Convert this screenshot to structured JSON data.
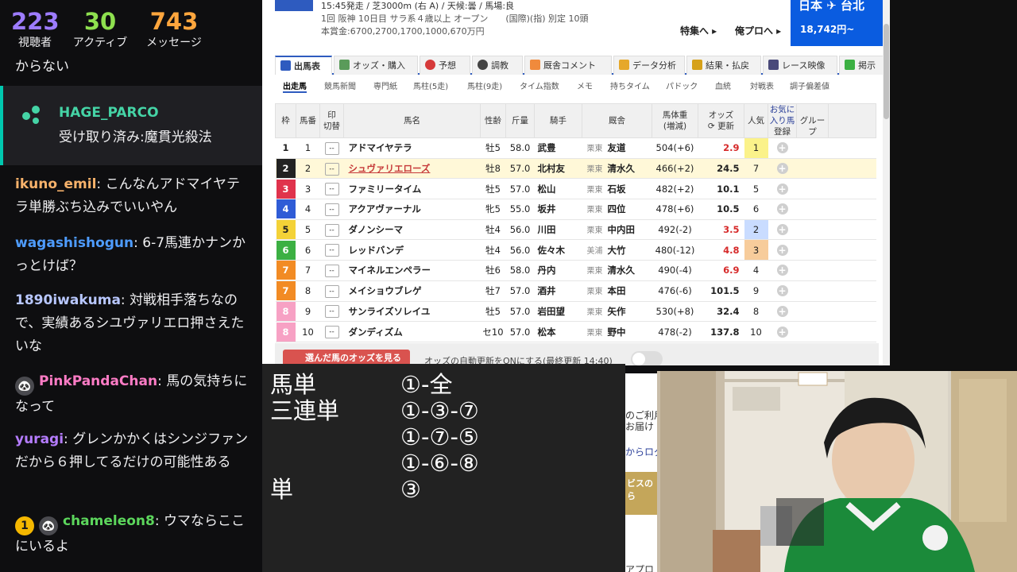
{
  "chat": {
    "stats": [
      {
        "value": "223",
        "label": "視聴者",
        "color": "#9d7cff"
      },
      {
        "value": "30",
        "label": "アクティブ",
        "color": "#8ee04f"
      },
      {
        "value": "743",
        "label": "メッセージ",
        "color": "#ffa63d"
      }
    ],
    "top_fragment": "からない",
    "redeem": {
      "user": "HAGE_PARCO",
      "text": "受け取り済み:魔貫光殺法"
    },
    "messages": [
      {
        "user": "ikuno_emil",
        "color": "#f7b26b",
        "text": "こんなんアドマイヤテラ単勝ぶち込みでいいやん"
      },
      {
        "user": "wagashishogun",
        "color": "#4e9cff",
        "text": "6-7馬連かナンかっとけば？"
      },
      {
        "user": "1890iwakuma",
        "color": "#b8c7ff",
        "text": "対戦相手落ちなので、実績あるシユヴァリエロ押さえたいな"
      },
      {
        "user": "PinkPandaChan",
        "color": "#ff7cc6",
        "text": "馬の気持ちになって"
      },
      {
        "user": "yuragi",
        "color": "#b57cff",
        "text": "グレンかかくはシンジファンだから６押してるだけの可能性ある"
      },
      {
        "user": "chameleon8",
        "color": "#5cd65c",
        "text": "ウマならここにいるよ",
        "badge": "1"
      }
    ]
  },
  "race": {
    "line1": "15:45発走 / 芝3000m (右 A) / 天候:曇 / 馬場:良",
    "line2": "1回 阪神 10日目 サラ系４歳以上 オープン　　(国際)(指) 別定 10頭",
    "line3": "本賞金:6700,2700,1700,1000,670万円",
    "link_special": "特集へ ▸",
    "link_pro": "俺プロへ ▸",
    "ad_title": "日本 ✈ 台北",
    "ad_price": "18,742円~",
    "tabs": [
      "出馬表",
      "オッズ・購入",
      "予想",
      "調教",
      "厩舎コメント",
      "データ分析",
      "結果・払戻",
      "レース映像",
      "掲示"
    ],
    "subtabs": [
      "出走馬",
      "競馬新聞",
      "専門紙",
      "馬柱(5走)",
      "馬柱(9走)",
      "タイム指数",
      "メモ",
      "持ちタイム",
      "パドック",
      "血統",
      "対戦表",
      "調子偏差値"
    ],
    "headers": {
      "waku": "枠",
      "umaban": "馬番",
      "mark": "印",
      "mark_sub": "切替",
      "name": "馬名",
      "sexage": "性齢",
      "weight": "斤量",
      "jockey": "騎手",
      "trainer": "厩舎",
      "body": "馬体重",
      "body_sub": "(増減)",
      "odds": "オッズ",
      "odds_sub": "更新",
      "pop": "人気",
      "fav": "お気に入り馬",
      "fav_reg": "登録",
      "fav_group": "グループ"
    },
    "waku_colors": [
      "#ffffff",
      "#222222",
      "#e0334c",
      "#2f5cd6",
      "#f4d237",
      "#3cb043",
      "#f28b24",
      "#f7a1c4"
    ],
    "horses": [
      {
        "waku": "1",
        "num": "1",
        "name": "アドマイヤテラ",
        "sexage": "牡5",
        "kin": "58.0",
        "jockey": "武豊",
        "region": "栗東",
        "trainer": "友道",
        "body": "504(+6)",
        "odds": "2.9",
        "red": true,
        "pop": "1"
      },
      {
        "waku": "2",
        "num": "2",
        "name": "シュヴァリエローズ",
        "sexage": "牡8",
        "kin": "57.0",
        "jockey": "北村友",
        "region": "栗東",
        "trainer": "清水久",
        "body": "466(+2)",
        "odds": "24.5",
        "red": false,
        "pop": "7"
      },
      {
        "waku": "3",
        "num": "3",
        "name": "ファミリータイム",
        "sexage": "牡5",
        "kin": "57.0",
        "jockey": "松山",
        "region": "栗東",
        "trainer": "石坂",
        "body": "482(+2)",
        "odds": "10.1",
        "red": false,
        "pop": "5"
      },
      {
        "waku": "4",
        "num": "4",
        "name": "アクアヴァーナル",
        "sexage": "牝5",
        "kin": "55.0",
        "jockey": "坂井",
        "region": "栗東",
        "trainer": "四位",
        "body": "478(+6)",
        "odds": "10.5",
        "red": false,
        "pop": "6"
      },
      {
        "waku": "5",
        "num": "5",
        "name": "ダノンシーマ",
        "sexage": "牡4",
        "kin": "56.0",
        "jockey": "川田",
        "region": "栗東",
        "trainer": "中内田",
        "body": "492(-2)",
        "odds": "3.5",
        "red": true,
        "pop": "2"
      },
      {
        "waku": "6",
        "num": "6",
        "name": "レッドバンデ",
        "sexage": "牡4",
        "kin": "56.0",
        "jockey": "佐々木",
        "region": "美浦",
        "trainer": "大竹",
        "body": "480(-12)",
        "odds": "4.8",
        "red": true,
        "pop": "3"
      },
      {
        "waku": "7",
        "num": "7",
        "name": "マイネルエンペラー",
        "sexage": "牡6",
        "kin": "58.0",
        "jockey": "丹内",
        "region": "栗東",
        "trainer": "清水久",
        "body": "490(-4)",
        "odds": "6.9",
        "red": true,
        "pop": "4"
      },
      {
        "waku": "7",
        "num": "8",
        "name": "メイショウブレゲ",
        "sexage": "牡7",
        "kin": "57.0",
        "jockey": "酒井",
        "region": "栗東",
        "trainer": "本田",
        "body": "476(-6)",
        "odds": "101.5",
        "red": false,
        "pop": "9"
      },
      {
        "waku": "8",
        "num": "9",
        "name": "サンライズソレイユ",
        "sexage": "牡5",
        "kin": "57.0",
        "jockey": "岩田望",
        "region": "栗東",
        "trainer": "矢作",
        "body": "530(+8)",
        "odds": "32.4",
        "red": false,
        "pop": "8"
      },
      {
        "waku": "8",
        "num": "10",
        "name": "ダンディズム",
        "sexage": "セ10",
        "kin": "57.0",
        "jockey": "松本",
        "region": "栗東",
        "trainer": "野中",
        "body": "478(-2)",
        "odds": "137.8",
        "red": false,
        "pop": "10"
      }
    ],
    "odds_button": "選んだ馬のオッズを見る",
    "auto_update": "オッズの自動更新をONにする(最終更新 14:40)"
  },
  "bets": [
    {
      "type": "馬単",
      "combos": [
        "①-全"
      ]
    },
    {
      "type": "三連単",
      "combos": [
        "①-③-⑦",
        "①-⑦-⑤",
        "①-⑥-⑧"
      ]
    },
    {
      "type": "単",
      "combos": [
        "③"
      ]
    }
  ],
  "web_fragment": [
    "のご利用",
    "お届け",
    "からログ",
    "ビスの",
    "ら",
    "アプロ"
  ]
}
